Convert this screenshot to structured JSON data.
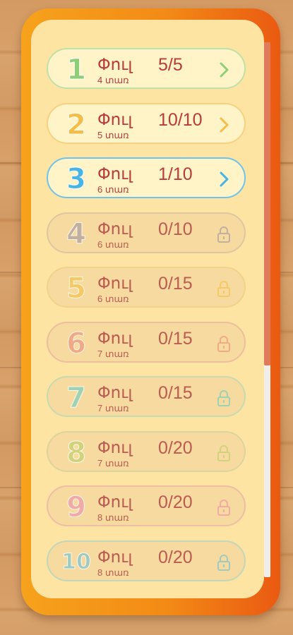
{
  "levels": [
    {
      "number": "1",
      "title": "Փուլ",
      "score": "5/5",
      "subtitle": "4 տառ",
      "locked": false,
      "color": "#8fce78",
      "border": "#bfe0a6"
    },
    {
      "number": "2",
      "title": "Փուլ",
      "score": "10/10",
      "subtitle": "5 տառ",
      "locked": false,
      "color": "#f3bd48",
      "border": "#f5d27f"
    },
    {
      "number": "3",
      "title": "Փուլ",
      "score": "1/10",
      "subtitle": "6 տառ",
      "locked": false,
      "color": "#46b4e5",
      "border": "#6fc3ea"
    },
    {
      "number": "4",
      "title": "Փուլ",
      "score": "0/10",
      "subtitle": "6 տառ",
      "locked": true,
      "color": "#b7a6a0",
      "border": "#d8c2a0"
    },
    {
      "number": "5",
      "title": "Փուլ",
      "score": "0/15",
      "subtitle": "6 տառ",
      "locked": true,
      "color": "#f4c55a",
      "border": "#f0cf85"
    },
    {
      "number": "6",
      "title": "Փուլ",
      "score": "0/15",
      "subtitle": "7 տառ",
      "locked": true,
      "color": "#f0a083",
      "border": "#eab89a"
    },
    {
      "number": "7",
      "title": "Փուլ",
      "score": "0/15",
      "subtitle": "7 տառ",
      "locked": true,
      "color": "#8fcfb6",
      "border": "#bcdab0"
    },
    {
      "number": "8",
      "title": "Փուլ",
      "score": "0/20",
      "subtitle": "7 տառ",
      "locked": true,
      "color": "#c9cf76",
      "border": "#d6d29b"
    },
    {
      "number": "9",
      "title": "Փուլ",
      "score": "0/20",
      "subtitle": "8 տառ",
      "locked": true,
      "color": "#f0a0a6",
      "border": "#ebb7a5"
    },
    {
      "number": "10",
      "title": "Փուլ",
      "score": "0/20",
      "subtitle": "8 տառ",
      "locked": true,
      "color": "#8fc6c8",
      "border": "#b8d5bd"
    }
  ],
  "icons": {
    "unlocked": "chevron-right-icon",
    "locked": "lock-icon"
  },
  "colors": {
    "text": "#b83b3b",
    "panel": "#fde4a3",
    "frame": "#f38b16"
  }
}
